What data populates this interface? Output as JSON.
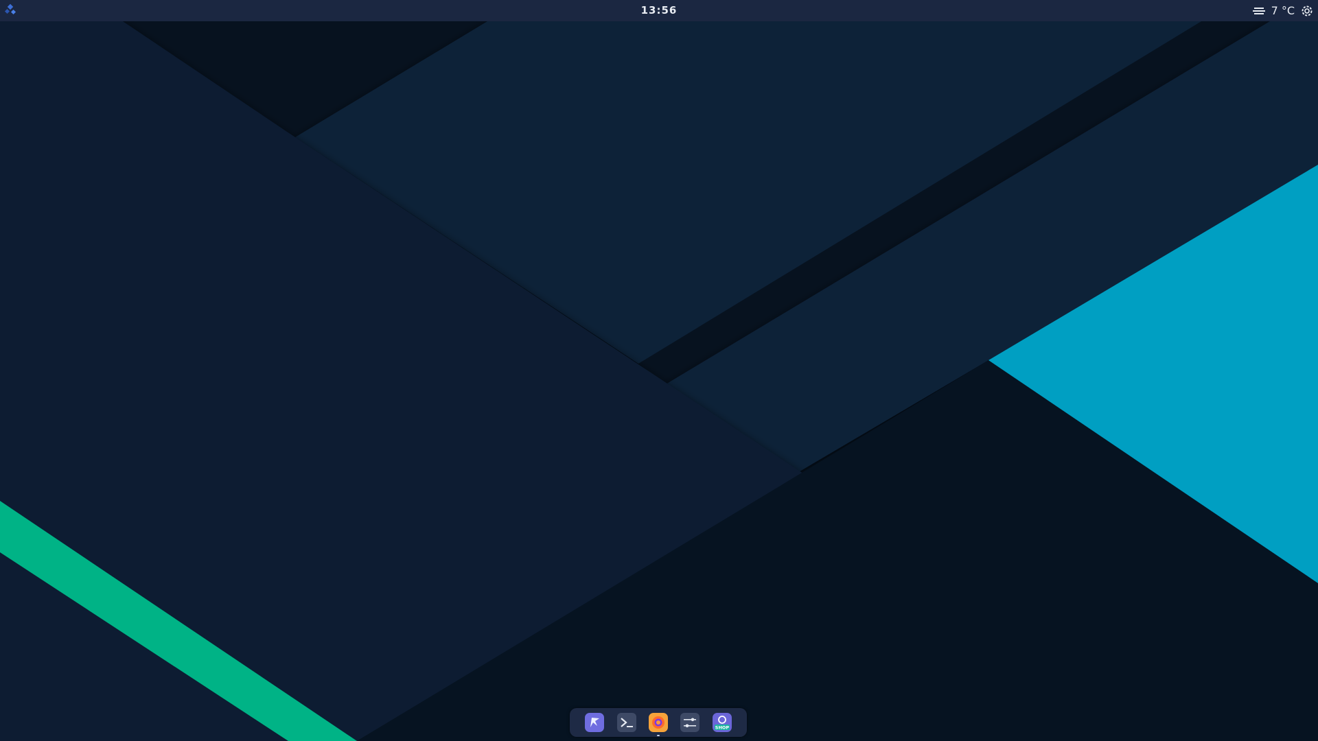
{
  "topbar": {
    "clock": "13:56",
    "weather": {
      "icon": "fog-icon",
      "temperature": "7 °C"
    },
    "activities_icon": "distro-logo-icon",
    "settings_icon": "gear-icon"
  },
  "dock": {
    "items": [
      {
        "name": "dolphin-file-manager",
        "icon": "dolphin-icon",
        "running": false
      },
      {
        "name": "terminal",
        "icon": "terminal-icon",
        "running": false
      },
      {
        "name": "firefox",
        "icon": "firefox-icon",
        "running": true
      },
      {
        "name": "settings",
        "icon": "sliders-icon",
        "running": false
      },
      {
        "name": "software-shop",
        "icon": "shop-icon",
        "label": "SHOP",
        "running": false
      }
    ]
  },
  "colors": {
    "topbar_bg": "#1b2741",
    "wallpaper_dark": "#0a1a2c",
    "wallpaper_mid": "#0e2138",
    "accent_cyan": "#009fc2",
    "accent_green": "#00b386"
  }
}
